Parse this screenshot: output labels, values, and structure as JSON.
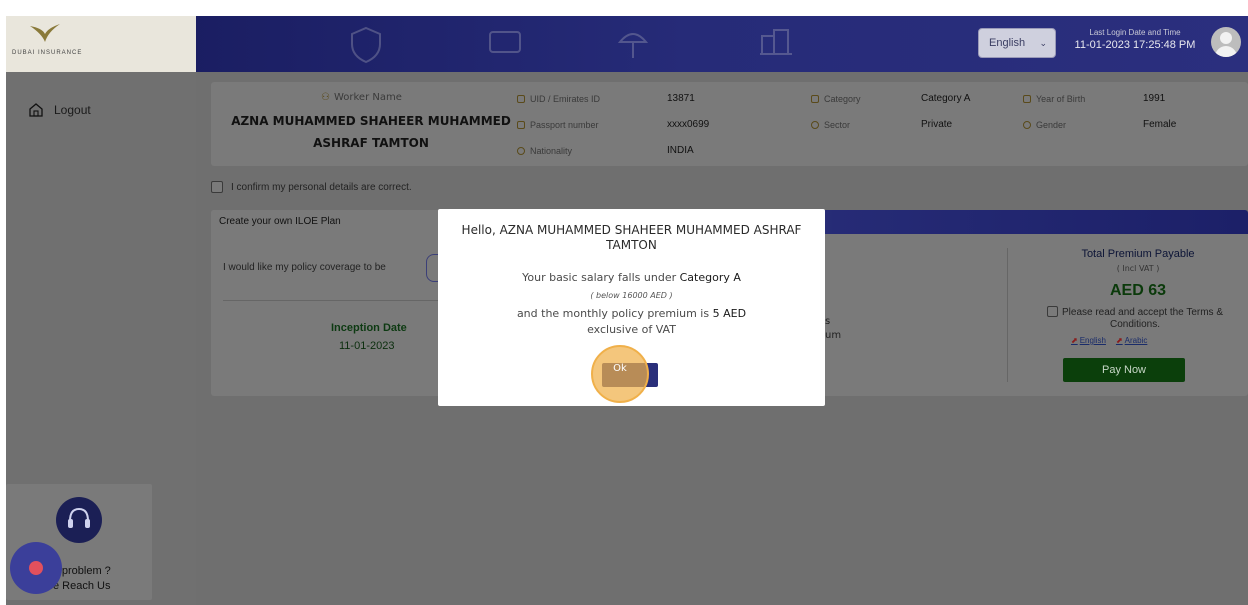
{
  "header": {
    "logo_text": "DUBAI INSURANCE",
    "language": "English",
    "last_login_label": "Last Login Date and Time",
    "last_login_value": "11-01-2023 17:25:48 PM"
  },
  "sidebar": {
    "logout_label": "Logout",
    "help_line1": "ny problem ?",
    "help_line2": "se Reach Us"
  },
  "worker": {
    "name_label": "Worker Name",
    "name": "AZNA MUHAMMED SHAHEER MUHAMMED ASHRAF TAMTON",
    "uid_label": "UID / Emirates ID",
    "uid_value": "13871",
    "passport_label": "Passport number",
    "passport_value": "xxxx0699",
    "nationality_label": "Nationality",
    "nationality_value": "INDIA",
    "category_label": "Category",
    "category_value": "Category A",
    "sector_label": "Sector",
    "sector_value": "Private",
    "yob_label": "Year of Birth",
    "yob_value": "1991",
    "gender_label": "Gender",
    "gender_value": "Female"
  },
  "confirm_text": "I confirm my personal details are correct.",
  "plan": {
    "title": "Create your own ILOE Plan",
    "coverage_text": "I would like my policy coverage to be",
    "inception_label": "Inception Date",
    "inception_value": "11-01-2023",
    "frag1": "s",
    "frag2": "um",
    "total_label": "Total Premium Payable",
    "incl_vat": "( Incl VAT )",
    "amount": "AED 63",
    "terms_text": "Please read and accept the Terms & Conditions.",
    "link_english": "English",
    "link_arabic": "Arabic",
    "pay_label": "Pay Now"
  },
  "modal": {
    "greeting": "Hello, AZNA MUHAMMED SHAHEER MUHAMMED ASHRAF TAMTON",
    "salary_prefix": "Your basic salary falls under",
    "salary_category": "Category A",
    "below_text": "( below 16000 AED )",
    "premium_prefix": "and the monthly policy premium is",
    "premium_value": "5 AED",
    "vat_text": "exclusive of VAT",
    "ok_label": "Ok"
  },
  "colors": {
    "header_bg": "#262b78",
    "overlay": "#707070",
    "pay_button": "#0b3f0b",
    "highlight": "#f0b04a"
  }
}
